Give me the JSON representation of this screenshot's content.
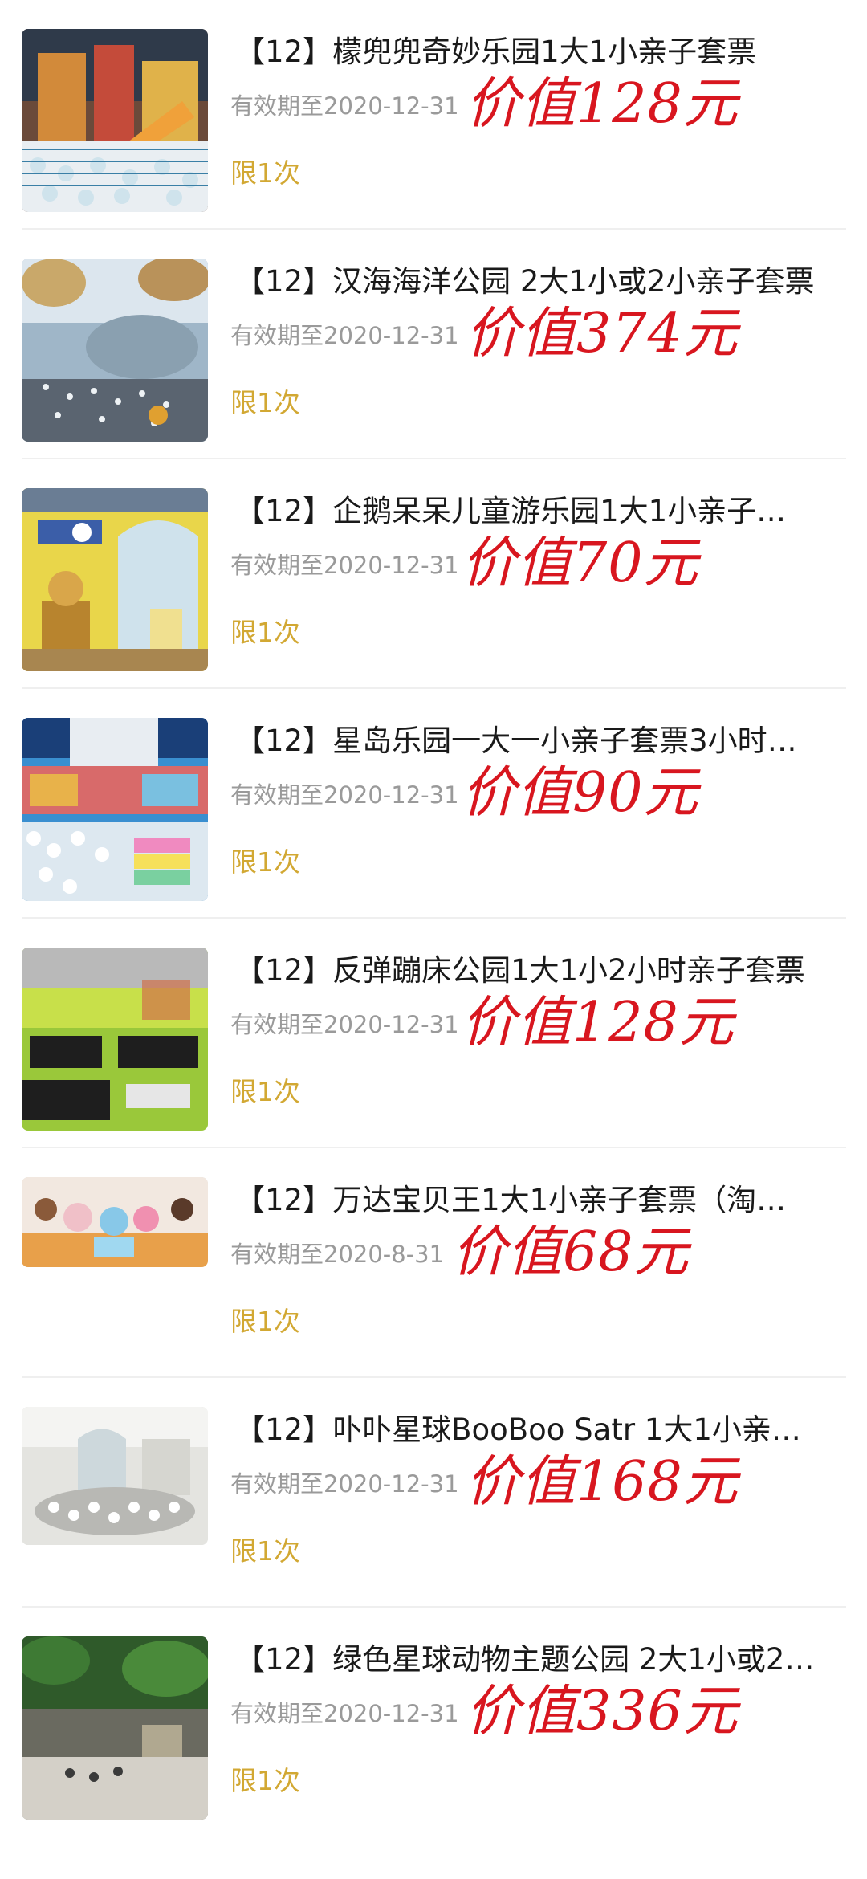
{
  "items": [
    {
      "title": "【12】檬兜兜奇妙乐园1大1小亲子套票",
      "expiry": "有效期至2020-12-31",
      "value": "价值128元",
      "limit": "限1次",
      "image_icon": "indoor-playground-photo"
    },
    {
      "title": "【12】汉海海洋公园 2大1小或2小亲子套票",
      "expiry": "有效期至2020-12-31",
      "value": "价值374元",
      "limit": "限1次",
      "image_icon": "ocean-park-photo"
    },
    {
      "title": "【12】企鹅呆呆儿童游乐园1大1小亲子…",
      "expiry": "有效期至2020-12-31",
      "value": "价值70元",
      "limit": "限1次",
      "image_icon": "penguin-playground-photo"
    },
    {
      "title": "【12】星岛乐园一大一小亲子套票3小时…",
      "expiry": "有效期至2020-12-31",
      "value": "价值90元",
      "limit": "限1次",
      "image_icon": "ball-pit-playground-photo"
    },
    {
      "title": "【12】反弹蹦床公园1大1小2小时亲子套票",
      "expiry": "有效期至2020-12-31",
      "value": "价值128元",
      "limit": "限1次",
      "image_icon": "trampoline-park-photo"
    },
    {
      "title": "【12】万达宝贝王1大1小亲子套票（淘…",
      "expiry": "有效期至2020-8-31",
      "value": "价值68元",
      "limit": "限1次",
      "image_icon": "kids-plush-toys-photo"
    },
    {
      "title": "【12】卟卟星球BooBoo Satr 1大1小亲…",
      "expiry": "有效期至2020-12-31",
      "value": "价值168元",
      "limit": "限1次",
      "image_icon": "white-ball-pit-photo"
    },
    {
      "title": "【12】绿色星球动物主题公园 2大1小或2…",
      "expiry": "有效期至2020-12-31",
      "value": "价值336元",
      "limit": "限1次",
      "image_icon": "animal-theme-park-photo"
    }
  ],
  "colors": {
    "title": "#1a1a1a",
    "expiry": "#9a9a9a",
    "value": "#d8161f",
    "limit": "#d2a833",
    "divider": "#efefef"
  }
}
